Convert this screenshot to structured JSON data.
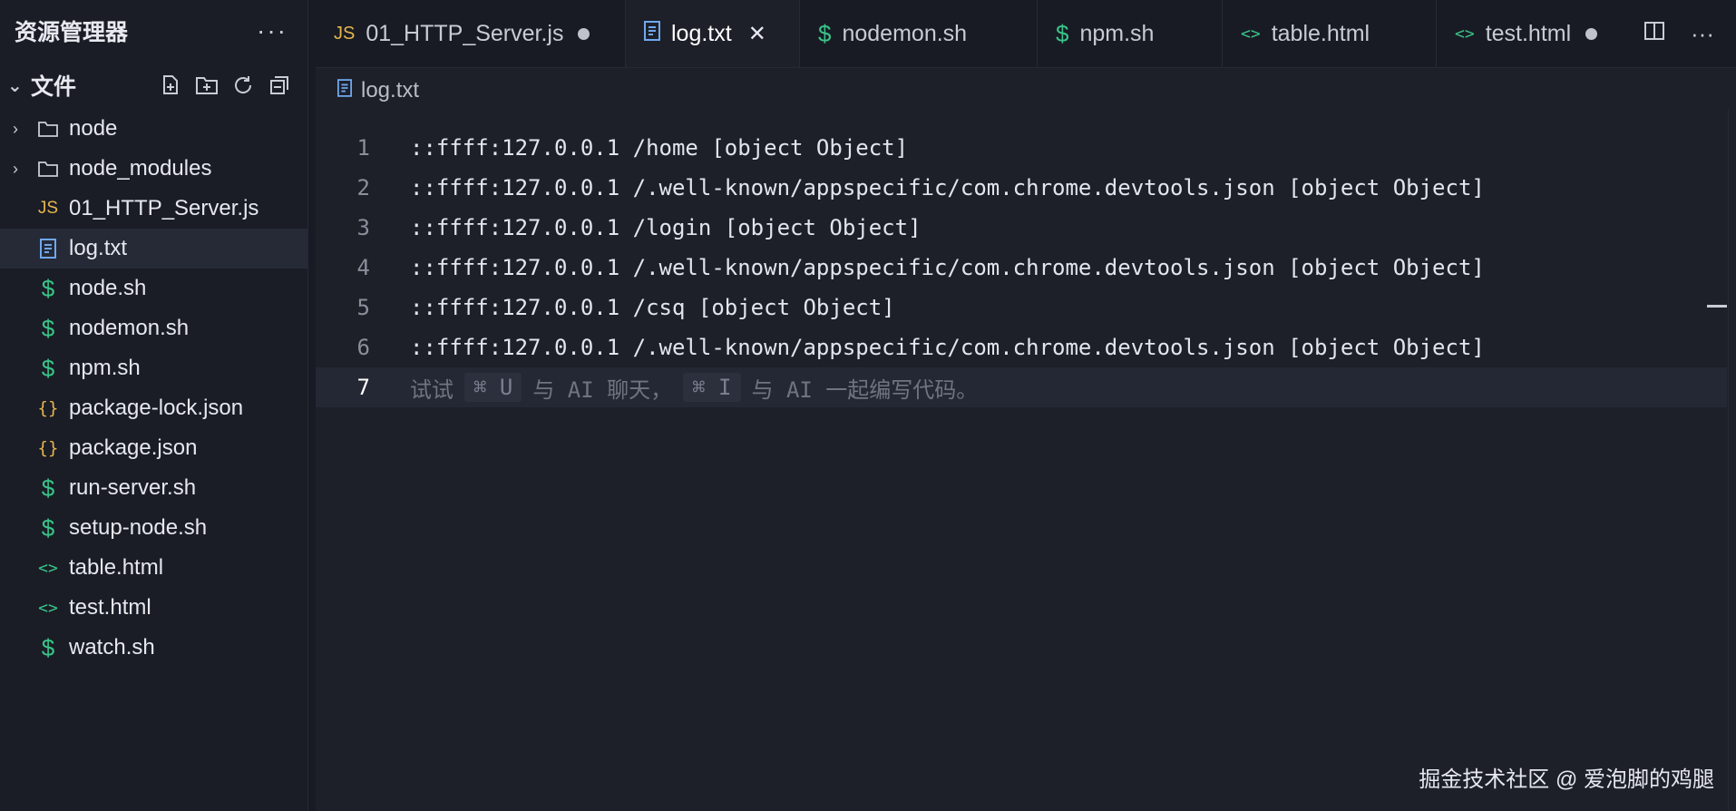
{
  "sidebar": {
    "title": "资源管理器",
    "more_label": "···",
    "folder": {
      "title": "文件"
    },
    "items": [
      {
        "label": "node",
        "icon": "folder-icon",
        "type": "folder"
      },
      {
        "label": "node_modules",
        "icon": "folder-icon",
        "type": "folder"
      },
      {
        "label": "01_HTTP_Server.js",
        "icon": "js-icon",
        "type": "js",
        "badge": "JS"
      },
      {
        "label": "log.txt",
        "icon": "text-file-icon",
        "type": "txt",
        "active": true
      },
      {
        "label": "node.sh",
        "icon": "shell-icon",
        "type": "sh"
      },
      {
        "label": "nodemon.sh",
        "icon": "shell-icon",
        "type": "sh"
      },
      {
        "label": "npm.sh",
        "icon": "shell-icon",
        "type": "sh"
      },
      {
        "label": "package-lock.json",
        "icon": "json-icon",
        "type": "json"
      },
      {
        "label": "package.json",
        "icon": "json-icon",
        "type": "json"
      },
      {
        "label": "run-server.sh",
        "icon": "shell-icon",
        "type": "sh"
      },
      {
        "label": "setup-node.sh",
        "icon": "shell-icon",
        "type": "sh"
      },
      {
        "label": "table.html",
        "icon": "html-icon",
        "type": "html"
      },
      {
        "label": "test.html",
        "icon": "html-icon",
        "type": "html"
      },
      {
        "label": "watch.sh",
        "icon": "shell-icon",
        "type": "sh"
      }
    ]
  },
  "tabs": [
    {
      "label": "01_HTTP_Server.js",
      "badge": "JS",
      "modified": true
    },
    {
      "label": "log.txt",
      "active": true
    },
    {
      "label": "nodemon.sh"
    },
    {
      "label": "npm.sh"
    },
    {
      "label": "table.html"
    },
    {
      "label": "test.html",
      "modified": true
    }
  ],
  "tab_actions": {
    "more_label": "···"
  },
  "breadcrumb": {
    "file": "log.txt"
  },
  "editor": {
    "lines": [
      {
        "num": "1",
        "text": "::ffff:127.0.0.1 /home [object Object]"
      },
      {
        "num": "2",
        "text": "::ffff:127.0.0.1 /.well-known/appspecific/com.chrome.devtools.json [object Object]"
      },
      {
        "num": "3",
        "text": "::ffff:127.0.0.1 /login [object Object]"
      },
      {
        "num": "4",
        "text": "::ffff:127.0.0.1 /.well-known/appspecific/com.chrome.devtools.json [object Object]"
      },
      {
        "num": "5",
        "text": "::ffff:127.0.0.1 /csq [object Object]"
      },
      {
        "num": "6",
        "text": "::ffff:127.0.0.1 /.well-known/appspecific/com.chrome.devtools.json [object Object]"
      }
    ],
    "current_line": {
      "num": "7",
      "hint_prefix": "试试",
      "key1": "⌘ U",
      "hint_mid": "与 AI 聊天，",
      "key2": "⌘ I",
      "hint_suffix": "与 AI 一起编写代码。"
    }
  },
  "watermark": "掘金技术社区 @ 爱泡脚的鸡腿",
  "colors": {
    "background": "#181b24",
    "js": "#e5b54e",
    "shell": "#39c488",
    "txt": "#6fa8f0"
  }
}
